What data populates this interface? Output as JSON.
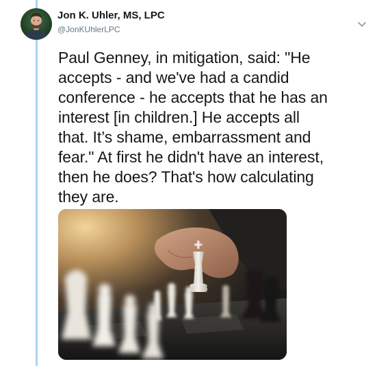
{
  "tweet": {
    "author_name": "Jon K. Uhler, MS, LPC",
    "author_handle": "@JonKUhlerLPC",
    "text_lines": [
      "Paul Genney, in mitigation, said: \"He",
      "accepts - and we've had a candid",
      "conference - he accepts that he has an",
      "interest [in children.]  He accepts all",
      "that. It’s shame, embarrassment and",
      "fear.\" At first he didn't have an interest,",
      "then he does? That's how calculating",
      "they are."
    ],
    "media_description_icon": "chess-photo",
    "menu_icon": "chevron-down-icon"
  },
  "colors": {
    "thread_line": "#a8d5f3",
    "handle": "#657786",
    "text": "#14171a",
    "chevron": "#8899a6"
  }
}
